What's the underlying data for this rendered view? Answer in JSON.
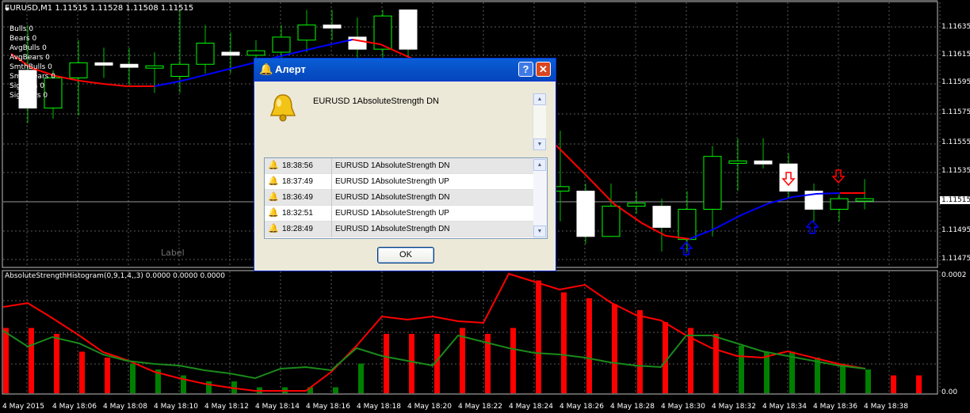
{
  "header": {
    "symbol": "EURUSD,M1",
    "ohlc": "1.11515 1.11528 1.11508 1.11515"
  },
  "indicator_values": [
    "Bulls 0",
    "Bears 0",
    "AvgBulls 0",
    "AvgBears 0",
    "SmthBulls 0",
    "SmthBears 0",
    "SigBulls 0",
    "SigBears 0"
  ],
  "label_object": "Label",
  "subwindow": {
    "title": "AbsoluteStrengthHistogram(0,9,1,4,,3) 0.0000 0.0000 0.0000",
    "scale_top": "0.0002",
    "scale_bottom": "0.00"
  },
  "price_scale": [
    "1.11635",
    "1.11615",
    "1.11595",
    "1.11575",
    "1.11555",
    "1.11535",
    "1.11495",
    "1.11475"
  ],
  "current_price": "1.11515",
  "time_axis": [
    "4 May 2015",
    "4 May 18:06",
    "4 May 18:08",
    "4 May 18:10",
    "4 May 18:12",
    "4 May 18:14",
    "4 May 18:16",
    "4 May 18:18",
    "4 May 18:20",
    "4 May 18:22",
    "4 May 18:24",
    "4 May 18:26",
    "4 May 18:28",
    "4 May 18:30",
    "4 May 18:32",
    "4 May 18:34",
    "4 May 18:36",
    "4 May 18:38"
  ],
  "alert": {
    "title": "Алерт",
    "message": "EURUSD 1AbsoluteStrength DN",
    "ok_label": "OK",
    "help_label": "?",
    "close_label": "✕",
    "log": [
      {
        "time": "18:38:56",
        "text": "EURUSD 1AbsoluteStrength DN"
      },
      {
        "time": "18:37:49",
        "text": "EURUSD 1AbsoluteStrength UP"
      },
      {
        "time": "18:36:49",
        "text": "EURUSD 1AbsoluteStrength DN"
      },
      {
        "time": "18:32:51",
        "text": "EURUSD 1AbsoluteStrength UP"
      },
      {
        "time": "18:28:49",
        "text": "EURUSD 1AbsoluteStrength DN"
      }
    ]
  },
  "colors": {
    "bull_candle": "#ffffff",
    "bear_candle_outline": "#00ff00",
    "wick": "#00c000",
    "ma_down": "#ff0000",
    "ma_up": "#0000ff",
    "hist_red": "#ff0000",
    "hist_green": "#008000",
    "signal_red": "#ff0000",
    "signal_green": "#1a8a1a",
    "grid": "#5a5a5a",
    "arrow_up": "#0000ff",
    "arrow_down": "#ff0000"
  },
  "chart_data": {
    "type": "candlestick",
    "candles": [
      {
        "o": 1.116,
        "h": 1.1163,
        "l": 1.11565,
        "c": 1.11575
      },
      {
        "o": 1.11575,
        "h": 1.116,
        "l": 1.11568,
        "c": 1.11595
      },
      {
        "o": 1.11595,
        "h": 1.1162,
        "l": 1.1157,
        "c": 1.11605
      },
      {
        "o": 1.11605,
        "h": 1.11615,
        "l": 1.11595,
        "c": 1.11604
      },
      {
        "o": 1.11604,
        "h": 1.11615,
        "l": 1.1159,
        "c": 1.11602
      },
      {
        "o": 1.11602,
        "h": 1.11612,
        "l": 1.11585,
        "c": 1.11603
      },
      {
        "o": 1.11596,
        "h": 1.1164,
        "l": 1.11585,
        "c": 1.11604
      },
      {
        "o": 1.11604,
        "h": 1.1163,
        "l": 1.11598,
        "c": 1.11618
      },
      {
        "o": 1.11612,
        "h": 1.11625,
        "l": 1.11598,
        "c": 1.1161
      },
      {
        "o": 1.1161,
        "h": 1.1162,
        "l": 1.116,
        "c": 1.11613
      },
      {
        "o": 1.11612,
        "h": 1.1163,
        "l": 1.11605,
        "c": 1.11622
      },
      {
        "o": 1.1162,
        "h": 1.1164,
        "l": 1.11612,
        "c": 1.1163
      },
      {
        "o": 1.1163,
        "h": 1.1164,
        "l": 1.1162,
        "c": 1.11628
      },
      {
        "o": 1.11622,
        "h": 1.11635,
        "l": 1.11605,
        "c": 1.11614
      },
      {
        "o": 1.11614,
        "h": 1.1164,
        "l": 1.11605,
        "c": 1.11636
      },
      {
        "o": 1.1164,
        "h": 1.1164,
        "l": 1.116,
        "c": 1.11614
      }
    ],
    "candles_right": [
      {
        "o": 1.1152,
        "h": 1.1156,
        "l": 1.115,
        "c": 1.11523
      },
      {
        "o": 1.1152,
        "h": 1.11525,
        "l": 1.11485,
        "c": 1.1149
      },
      {
        "o": 1.1149,
        "h": 1.11525,
        "l": 1.1149,
        "c": 1.1151
      },
      {
        "o": 1.1151,
        "h": 1.1152,
        "l": 1.11505,
        "c": 1.11512
      },
      {
        "o": 1.1151,
        "h": 1.11515,
        "l": 1.1148,
        "c": 1.11496
      },
      {
        "o": 1.11488,
        "h": 1.1152,
        "l": 1.1148,
        "c": 1.11508
      },
      {
        "o": 1.11508,
        "h": 1.1155,
        "l": 1.1149,
        "c": 1.11543
      },
      {
        "o": 1.1154,
        "h": 1.11555,
        "l": 1.1152,
        "c": 1.1154
      },
      {
        "o": 1.1154,
        "h": 1.11555,
        "l": 1.11535,
        "c": 1.11538
      },
      {
        "o": 1.11538,
        "h": 1.11545,
        "l": 1.11515,
        "c": 1.1152
      },
      {
        "o": 1.1152,
        "h": 1.11525,
        "l": 1.115,
        "c": 1.11508
      },
      {
        "o": 1.11508,
        "h": 1.11518,
        "l": 1.115,
        "c": 1.11515
      },
      {
        "o": 1.11515,
        "h": 1.11528,
        "l": 1.11508,
        "c": 1.11515
      }
    ],
    "histogram": {
      "values": [
        0.00011,
        0.00011,
        0.0001,
        7e-05,
        6e-05,
        5e-05,
        4e-05,
        3e-05,
        2e-05,
        2e-05,
        1e-05,
        1e-05,
        1e-05,
        1e-05,
        5e-05,
        0.0001,
        0.0001,
        0.0001,
        0.00011,
        0.0001,
        0.00011,
        0.00019,
        0.00017,
        0.00016,
        0.00015,
        0.00014,
        0.00012,
        0.00011,
        0.0001,
        8e-05,
        7e-05,
        7e-05,
        6e-05,
        5e-05,
        4e-05,
        3e-05,
        3e-05
      ],
      "colors": [
        "r",
        "r",
        "r",
        "r",
        "r",
        "g",
        "g",
        "g",
        "g",
        "g",
        "g",
        "g",
        "g",
        "g",
        "g",
        "r",
        "r",
        "r",
        "r",
        "r",
        "r",
        "r",
        "r",
        "r",
        "r",
        "r",
        "r",
        "r",
        "r",
        "g",
        "g",
        "g",
        "g",
        "g",
        "g",
        "r",
        "r"
      ]
    },
    "ylim_price": [
      1.1147,
      1.11645
    ],
    "ylim_hist": [
      0,
      0.0002
    ]
  }
}
